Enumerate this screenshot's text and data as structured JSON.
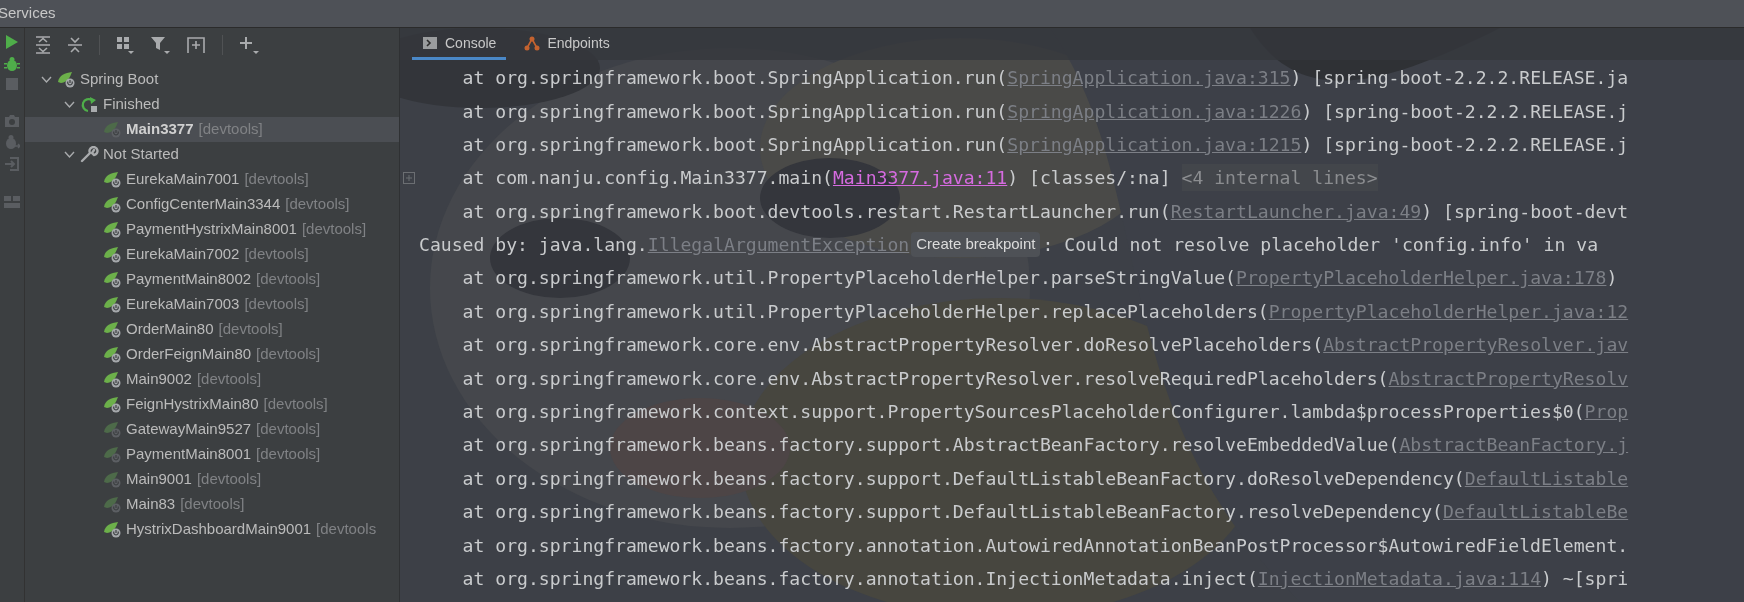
{
  "title": "Services",
  "tree": [
    {
      "kind": "spring",
      "label": "Spring Boot",
      "expanded": true,
      "children": [
        {
          "kind": "finished",
          "label": "Finished",
          "expanded": true,
          "children": [
            {
              "kind": "service",
              "label": "Main3377",
              "tag": "[devtools]",
              "dimmed": true,
              "selected": true
            }
          ]
        },
        {
          "kind": "not_started",
          "label": "Not Started",
          "expanded": true,
          "children": [
            {
              "kind": "service",
              "label": "EurekaMain7001",
              "tag": "[devtools]",
              "dimmed": false,
              "selected": false
            },
            {
              "kind": "service",
              "label": "ConfigCenterMain3344",
              "tag": "[devtools]",
              "dimmed": false,
              "selected": false
            },
            {
              "kind": "service",
              "label": "PaymentHystrixMain8001",
              "tag": "[devtools]",
              "dimmed": false,
              "selected": false
            },
            {
              "kind": "service",
              "label": "EurekaMain7002",
              "tag": "[devtools]",
              "dimmed": false,
              "selected": false
            },
            {
              "kind": "service",
              "label": "PaymentMain8002",
              "tag": "[devtools]",
              "dimmed": false,
              "selected": false
            },
            {
              "kind": "service",
              "label": "EurekaMain7003",
              "tag": "[devtools]",
              "dimmed": false,
              "selected": false
            },
            {
              "kind": "service",
              "label": "OrderMain80",
              "tag": "[devtools]",
              "dimmed": false,
              "selected": false
            },
            {
              "kind": "service",
              "label": "OrderFeignMain80",
              "tag": "[devtools]",
              "dimmed": false,
              "selected": false
            },
            {
              "kind": "service",
              "label": "Main9002",
              "tag": "[devtools]",
              "dimmed": false,
              "selected": false
            },
            {
              "kind": "service",
              "label": "FeignHystrixMain80",
              "tag": "[devtools]",
              "dimmed": false,
              "selected": false
            },
            {
              "kind": "service",
              "label": "GatewayMain9527",
              "tag": "[devtools]",
              "dimmed": true,
              "selected": false
            },
            {
              "kind": "service",
              "label": "PaymentMain8001",
              "tag": "[devtools]",
              "dimmed": true,
              "selected": false
            },
            {
              "kind": "service",
              "label": "Main9001",
              "tag": "[devtools]",
              "dimmed": true,
              "selected": false
            },
            {
              "kind": "service",
              "label": "Main83",
              "tag": "[devtools]",
              "dimmed": true,
              "selected": false
            },
            {
              "kind": "service",
              "label": "HystrixDashboardMain9001",
              "tag": "[devtools",
              "dimmed": false,
              "selected": false
            }
          ]
        }
      ]
    }
  ],
  "tabs": [
    {
      "kind": "console",
      "label": "Console",
      "selected": true
    },
    {
      "kind": "endpoints",
      "label": "Endpoints",
      "selected": false
    }
  ],
  "console": [
    {
      "kind": "frame",
      "segments": [
        {
          "kind": "text",
          "text": "    at org.springframework.boot.SpringApplication.run("
        },
        {
          "kind": "link",
          "text": "SpringApplication.java:315"
        },
        {
          "kind": "text",
          "text": ") [spring-boot-2.2.2.RELEASE.ja"
        }
      ]
    },
    {
      "kind": "frame",
      "segments": [
        {
          "kind": "text",
          "text": "    at org.springframework.boot.SpringApplication.run("
        },
        {
          "kind": "link",
          "text": "SpringApplication.java:1226"
        },
        {
          "kind": "text",
          "text": ") [spring-boot-2.2.2.RELEASE.j"
        }
      ]
    },
    {
      "kind": "frame",
      "segments": [
        {
          "kind": "text",
          "text": "    at org.springframework.boot.SpringApplication.run("
        },
        {
          "kind": "link",
          "text": "SpringApplication.java:1215"
        },
        {
          "kind": "text",
          "text": ") [spring-boot-2.2.2.RELEASE.j"
        }
      ]
    },
    {
      "kind": "folded",
      "segments": [
        {
          "kind": "text",
          "text": "    at com.nanju.config.Main3377.main("
        },
        {
          "kind": "own_link",
          "text": "Main3377.java:11"
        },
        {
          "kind": "text",
          "text": ") [classes/:na] "
        },
        {
          "kind": "muted",
          "text": "<4 internal lines>"
        }
      ]
    },
    {
      "kind": "frame",
      "segments": [
        {
          "kind": "text",
          "text": "    at org.springframework.boot.devtools.restart.RestartLauncher.run("
        },
        {
          "kind": "link",
          "text": "RestartLauncher.java:49"
        },
        {
          "kind": "text",
          "text": ") [spring-boot-devt"
        }
      ]
    },
    {
      "kind": "frame",
      "segments": [
        {
          "kind": "text",
          "text": "Caused by: java.lang."
        },
        {
          "kind": "link",
          "text": "IllegalArgumentException"
        },
        {
          "kind": "tooltip",
          "text": "Create breakpoint"
        },
        {
          "kind": "text",
          "text": ": Could not resolve placeholder 'config.info' in va"
        }
      ]
    },
    {
      "kind": "frame",
      "segments": [
        {
          "kind": "text",
          "text": "    at org.springframework.util.PropertyPlaceholderHelper.parseStringValue("
        },
        {
          "kind": "link",
          "text": "PropertyPlaceholderHelper.java:178"
        },
        {
          "kind": "text",
          "text": ")"
        }
      ]
    },
    {
      "kind": "frame",
      "segments": [
        {
          "kind": "text",
          "text": "    at org.springframework.util.PropertyPlaceholderHelper.replacePlaceholders("
        },
        {
          "kind": "link",
          "text": "PropertyPlaceholderHelper.java:12"
        }
      ]
    },
    {
      "kind": "frame",
      "segments": [
        {
          "kind": "text",
          "text": "    at org.springframework.core.env.AbstractPropertyResolver.doResolvePlaceholders("
        },
        {
          "kind": "link",
          "text": "AbstractPropertyResolver.jav"
        }
      ]
    },
    {
      "kind": "frame",
      "segments": [
        {
          "kind": "text",
          "text": "    at org.springframework.core.env.AbstractPropertyResolver.resolveRequiredPlaceholders("
        },
        {
          "kind": "link",
          "text": "AbstractPropertyResolv"
        }
      ]
    },
    {
      "kind": "frame",
      "segments": [
        {
          "kind": "text",
          "text": "    at org.springframework.context.support.PropertySourcesPlaceholderConfigurer.lambda$processProperties$0("
        },
        {
          "kind": "link",
          "text": "Prop"
        }
      ]
    },
    {
      "kind": "frame",
      "segments": [
        {
          "kind": "text",
          "text": "    at org.springframework.beans.factory.support.AbstractBeanFactory.resolveEmbeddedValue("
        },
        {
          "kind": "link",
          "text": "AbstractBeanFactory.j"
        }
      ]
    },
    {
      "kind": "frame",
      "segments": [
        {
          "kind": "text",
          "text": "    at org.springframework.beans.factory.support.DefaultListableBeanFactory.doResolveDependency("
        },
        {
          "kind": "link",
          "text": "DefaultListable"
        }
      ]
    },
    {
      "kind": "frame",
      "segments": [
        {
          "kind": "text",
          "text": "    at org.springframework.beans.factory.support.DefaultListableBeanFactory.resolveDependency("
        },
        {
          "kind": "link",
          "text": "DefaultListableBe"
        }
      ]
    },
    {
      "kind": "frame",
      "segments": [
        {
          "kind": "text",
          "text": "    at org.springframework.beans.factory.annotation.AutowiredAnnotationBeanPostProcessor$AutowiredFieldElement."
        }
      ]
    },
    {
      "kind": "frame",
      "segments": [
        {
          "kind": "text",
          "text": "    at org.springframework.beans.factory.annotation.InjectionMetadata.inject("
        },
        {
          "kind": "link",
          "text": "InjectionMetadata.java:114"
        },
        {
          "kind": "text",
          "text": ") ~[spri"
        }
      ]
    }
  ]
}
